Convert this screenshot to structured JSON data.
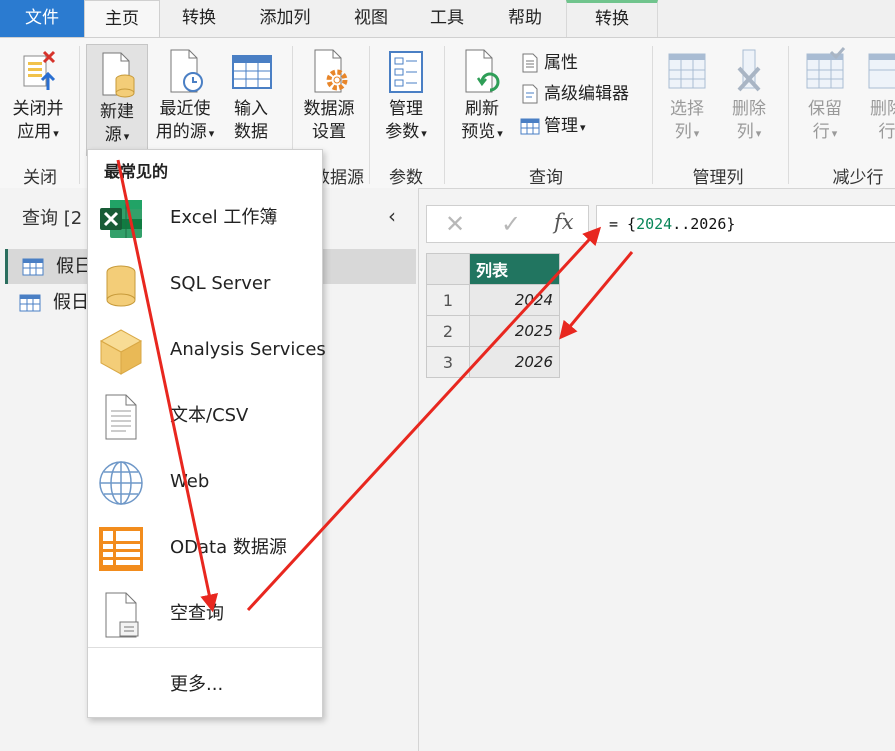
{
  "tabs": {
    "file": "文件",
    "home": "主页",
    "transform": "转换",
    "add_column": "添加列",
    "view": "视图",
    "tools": "工具",
    "help": "帮助",
    "context_transform": "转换"
  },
  "ribbon": {
    "close_apply": {
      "line1": "关闭并",
      "line2": "应用"
    },
    "new_source": {
      "line1": "新建",
      "line2": "源"
    },
    "recent_sources": {
      "line1": "最近使",
      "line2": "用的源"
    },
    "enter_data": {
      "line1": "输入",
      "line2": "数据"
    },
    "data_source_settings": {
      "line1": "数据源",
      "line2": "设置"
    },
    "manage_params": {
      "line1": "管理",
      "line2": "参数"
    },
    "refresh_preview": {
      "line1": "刷新",
      "line2": "预览"
    },
    "properties": "属性",
    "advanced_editor": "高级编辑器",
    "manage": "管理",
    "choose_columns": {
      "line1": "选择",
      "line2": "列"
    },
    "remove_columns": {
      "line1": "删除",
      "line2": "列"
    },
    "keep_rows": {
      "line1": "保留",
      "line2": "行"
    },
    "remove_rows": {
      "line1": "删除",
      "line2": "行"
    },
    "groups": {
      "close": "关闭",
      "data_source": "数据源",
      "parameters": "参数",
      "query": "查询",
      "manage_columns": "管理列",
      "reduce_rows": "减少行"
    }
  },
  "query_panel": {
    "title": "查询 [2",
    "items": [
      "假日",
      "假日"
    ]
  },
  "formula_bar": {
    "prefix": "= {",
    "start": "2024",
    "dots": "..",
    "end": "2026",
    "suffix": "}"
  },
  "grid": {
    "column_header": "列表",
    "rows": [
      {
        "index": "1",
        "value": "2024"
      },
      {
        "index": "2",
        "value": "2025"
      },
      {
        "index": "3",
        "value": "2026"
      }
    ]
  },
  "menu": {
    "header": "最常见的",
    "items": [
      {
        "label": "Excel 工作簿",
        "icon": "excel-icon"
      },
      {
        "label": "SQL Server",
        "icon": "database-icon"
      },
      {
        "label": "Analysis Services",
        "icon": "cube-icon"
      },
      {
        "label": "文本/CSV",
        "icon": "text-file-icon"
      },
      {
        "label": "Web",
        "icon": "globe-icon"
      },
      {
        "label": "OData 数据源",
        "icon": "odata-icon"
      },
      {
        "label": "空查询",
        "icon": "blank-query-icon"
      }
    ],
    "more": "更多..."
  },
  "colors": {
    "file_tab": "#2b7bd0",
    "grid_header": "#217560",
    "annotation_arrow": "#e8271f",
    "formula_number": "#098658"
  }
}
